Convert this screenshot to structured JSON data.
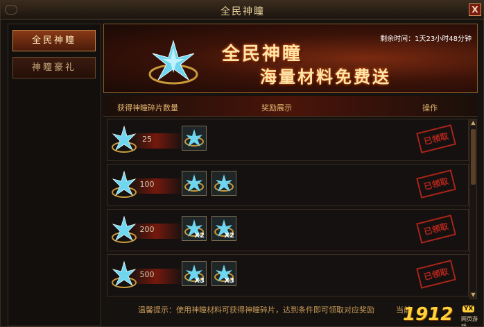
{
  "window": {
    "title": "全民神瞳",
    "close_label": "X"
  },
  "sidebar": {
    "tabs": [
      {
        "label": "全民神瞳"
      },
      {
        "label": "神瞳豪礼"
      }
    ]
  },
  "banner": {
    "title_line1": "全民神瞳",
    "title_line2": "海量材料免费送",
    "timer_text": "剩余时间：1天23小时48分钟"
  },
  "table": {
    "headers": {
      "count": "获得神瞳碎片数量",
      "rewards": "奖励展示",
      "action": "操作"
    },
    "rows": [
      {
        "count": "25",
        "rewards": [
          {
            "qty": ""
          }
        ],
        "status": "已领取"
      },
      {
        "count": "100",
        "rewards": [
          {
            "qty": ""
          },
          {
            "qty": ""
          }
        ],
        "status": "已领取"
      },
      {
        "count": "200",
        "rewards": [
          {
            "qty": "X2"
          },
          {
            "qty": "X2"
          }
        ],
        "status": "已领取"
      },
      {
        "count": "500",
        "rewards": [
          {
            "qty": "X3"
          },
          {
            "qty": "X3"
          }
        ],
        "status": "已领取"
      }
    ]
  },
  "footer": {
    "tip": "温馨提示：使用神瞳材料可获得神瞳碎片，达到条件即可领取对应奖励",
    "right_text": "当前"
  },
  "logo": {
    "text": "1912",
    "badge": "YX",
    "sub": "网页游戏"
  },
  "colors": {
    "accent": "#c99a5e",
    "stamp": "#c6281c",
    "banner_bg": "#5a1a0a"
  }
}
